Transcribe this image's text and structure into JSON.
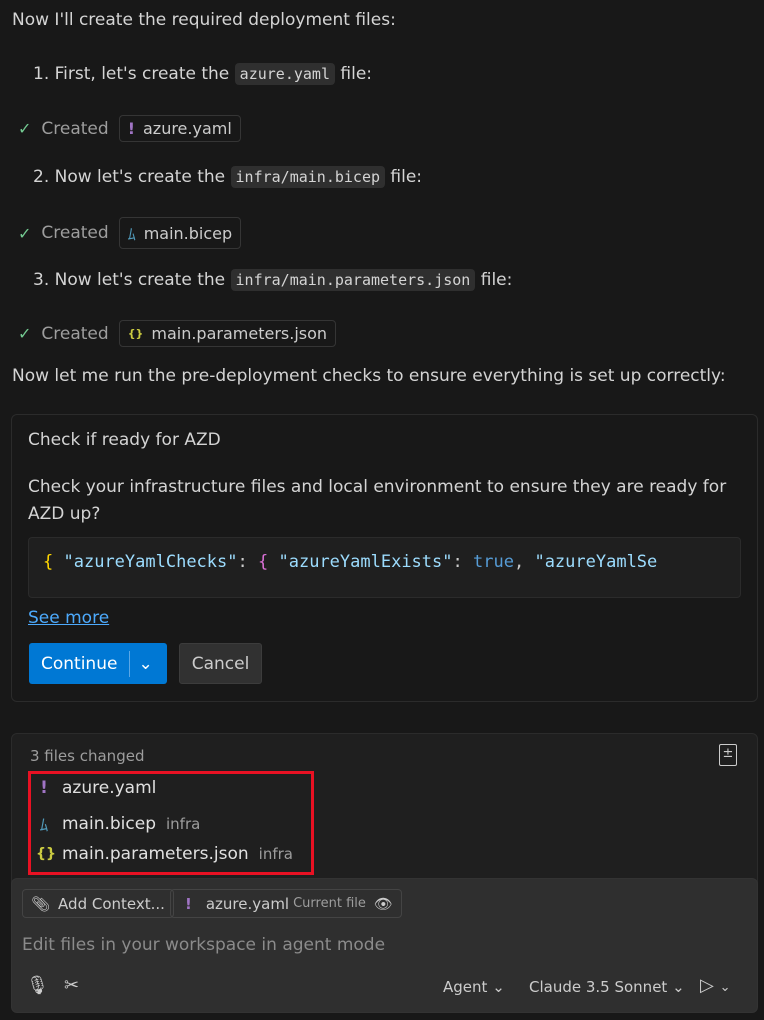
{
  "intro": "Now I'll create the required deployment files:",
  "steps": [
    {
      "prefix": "1. First, let's create the",
      "code": "azure.yaml",
      "suffix": "file:",
      "created_label": "Created",
      "file": "azure.yaml"
    },
    {
      "prefix": "2. Now let's create the",
      "code": "infra/main.bicep",
      "suffix": "file:",
      "created_label": "Created",
      "file": "main.bicep"
    },
    {
      "prefix": "3. Now let's create the",
      "code": "infra/main.parameters.json",
      "suffix": "file:",
      "created_label": "Created",
      "file": "main.parameters.json"
    }
  ],
  "outro": "Now let me run the pre-deployment checks to ensure everything is set up correctly:",
  "confirm": {
    "title": "Check if ready for AZD",
    "description": "Check your infrastructure files and local environment to ensure they are ready for AZD up?",
    "code": {
      "b1": "{",
      "k1": "\"azureYamlChecks\"",
      "c1": ":",
      "b2": "{",
      "k2": "\"azureYamlExists\"",
      "c2": ":",
      "v2": "true",
      "c3": ",",
      "k3": "\"azureYamlSe"
    },
    "see_more": "See more",
    "continue": "Continue",
    "cancel": "Cancel"
  },
  "changes": {
    "summary": "3 files changed",
    "files": [
      {
        "name": "azure.yaml",
        "dir": ""
      },
      {
        "name": "main.bicep",
        "dir": "infra"
      },
      {
        "name": "main.parameters.json",
        "dir": "infra"
      }
    ]
  },
  "chat": {
    "add_context": "Add Context...",
    "current_file": "azure.yaml",
    "current_file_label": "Current file",
    "placeholder": "Edit files in your workspace in agent mode",
    "mode": "Agent",
    "model": "Claude 3.5 Sonnet"
  }
}
